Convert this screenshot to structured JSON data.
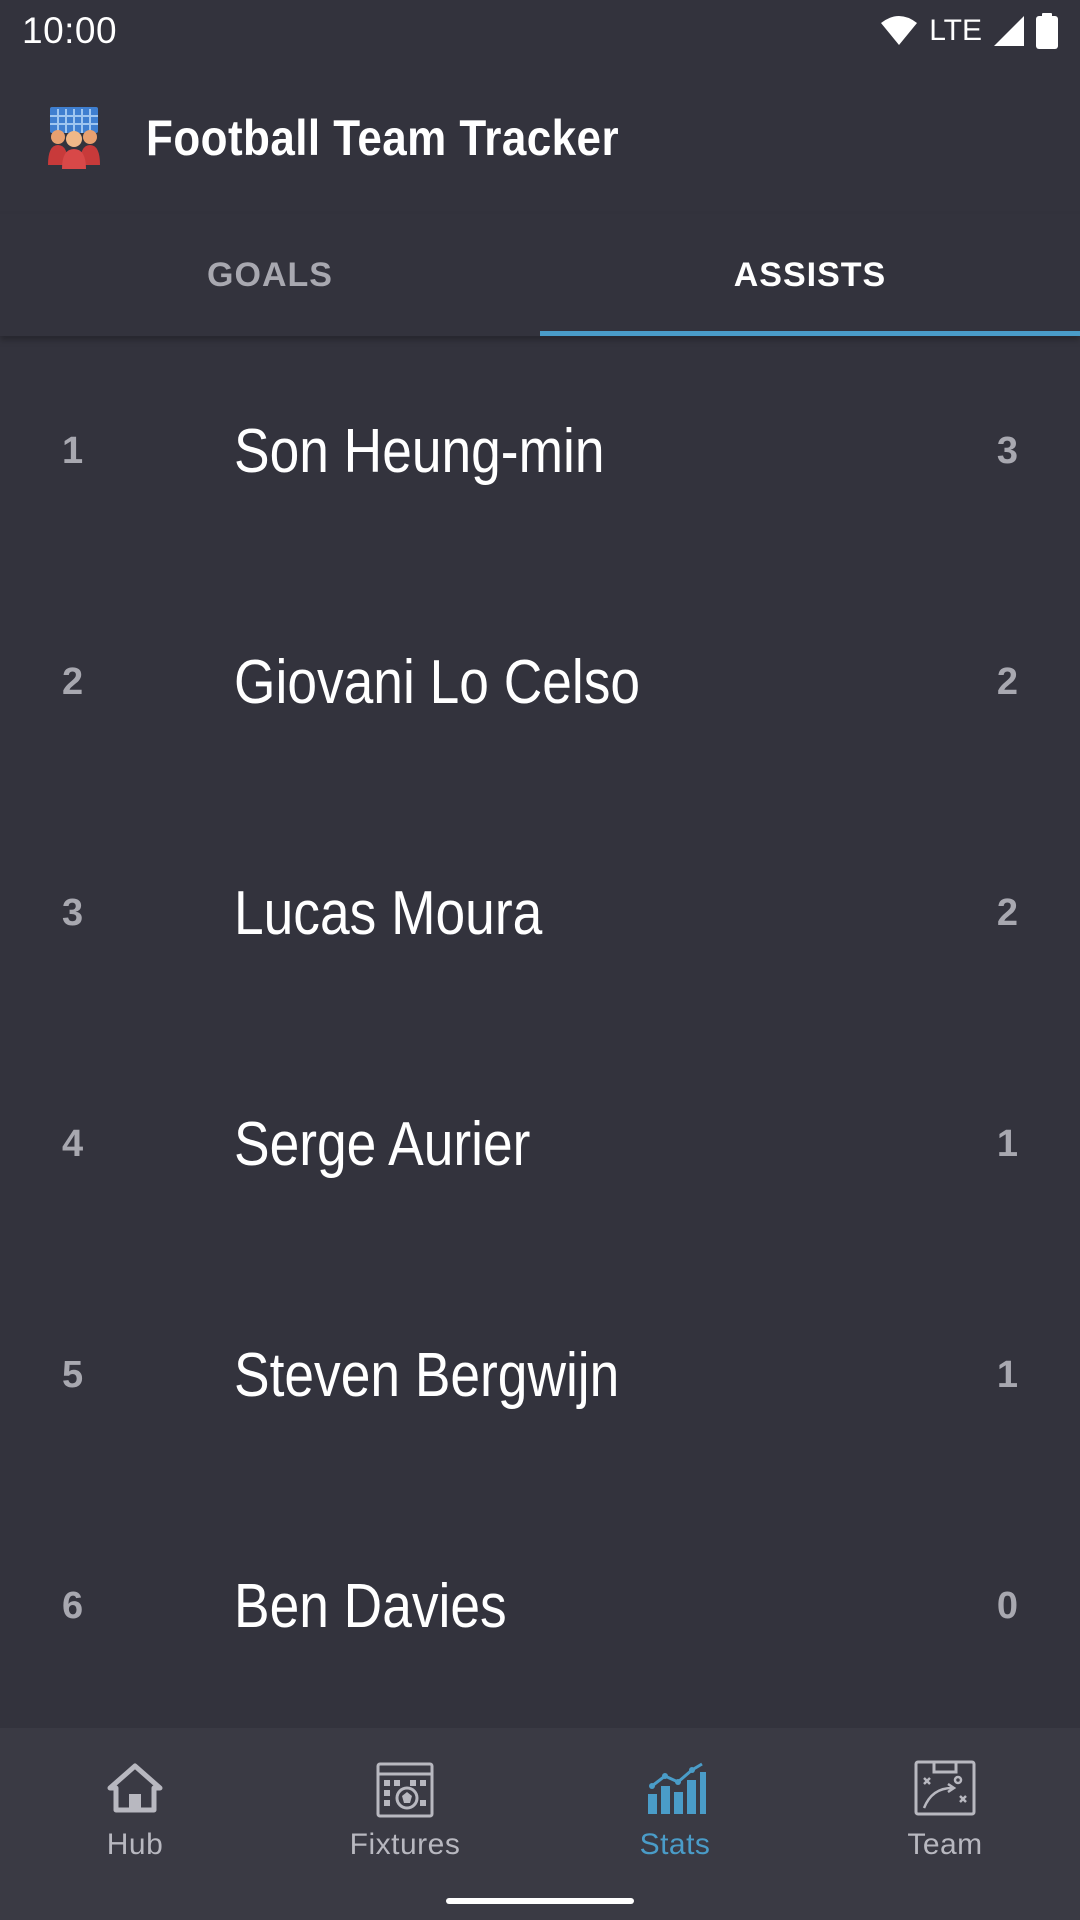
{
  "status_bar": {
    "time": "10:00",
    "network": "LTE"
  },
  "app_bar": {
    "title": "Football Team Tracker",
    "logo_icon": "team-logo-icon"
  },
  "tabs": [
    {
      "label": "GOALS",
      "active": false
    },
    {
      "label": "ASSISTS",
      "active": true
    }
  ],
  "players": [
    {
      "rank": "1",
      "name": "Son Heung-min",
      "count": "3"
    },
    {
      "rank": "2",
      "name": "Giovani Lo Celso",
      "count": "2"
    },
    {
      "rank": "3",
      "name": "Lucas Moura",
      "count": "2"
    },
    {
      "rank": "4",
      "name": "Serge Aurier",
      "count": "1"
    },
    {
      "rank": "5",
      "name": "Steven Bergwijn",
      "count": "1"
    },
    {
      "rank": "6",
      "name": "Ben Davies",
      "count": "0"
    }
  ],
  "bottom_nav": [
    {
      "label": "Hub",
      "icon": "home-icon",
      "active": false
    },
    {
      "label": "Fixtures",
      "icon": "calendar-icon",
      "active": false
    },
    {
      "label": "Stats",
      "icon": "bar-chart-icon",
      "active": true
    },
    {
      "label": "Team",
      "icon": "tactics-board-icon",
      "active": false
    }
  ],
  "colors": {
    "background": "#33333d",
    "accent": "#4a9cc8",
    "muted_text": "#a8a8b0",
    "nav_background": "#3a3a44"
  }
}
